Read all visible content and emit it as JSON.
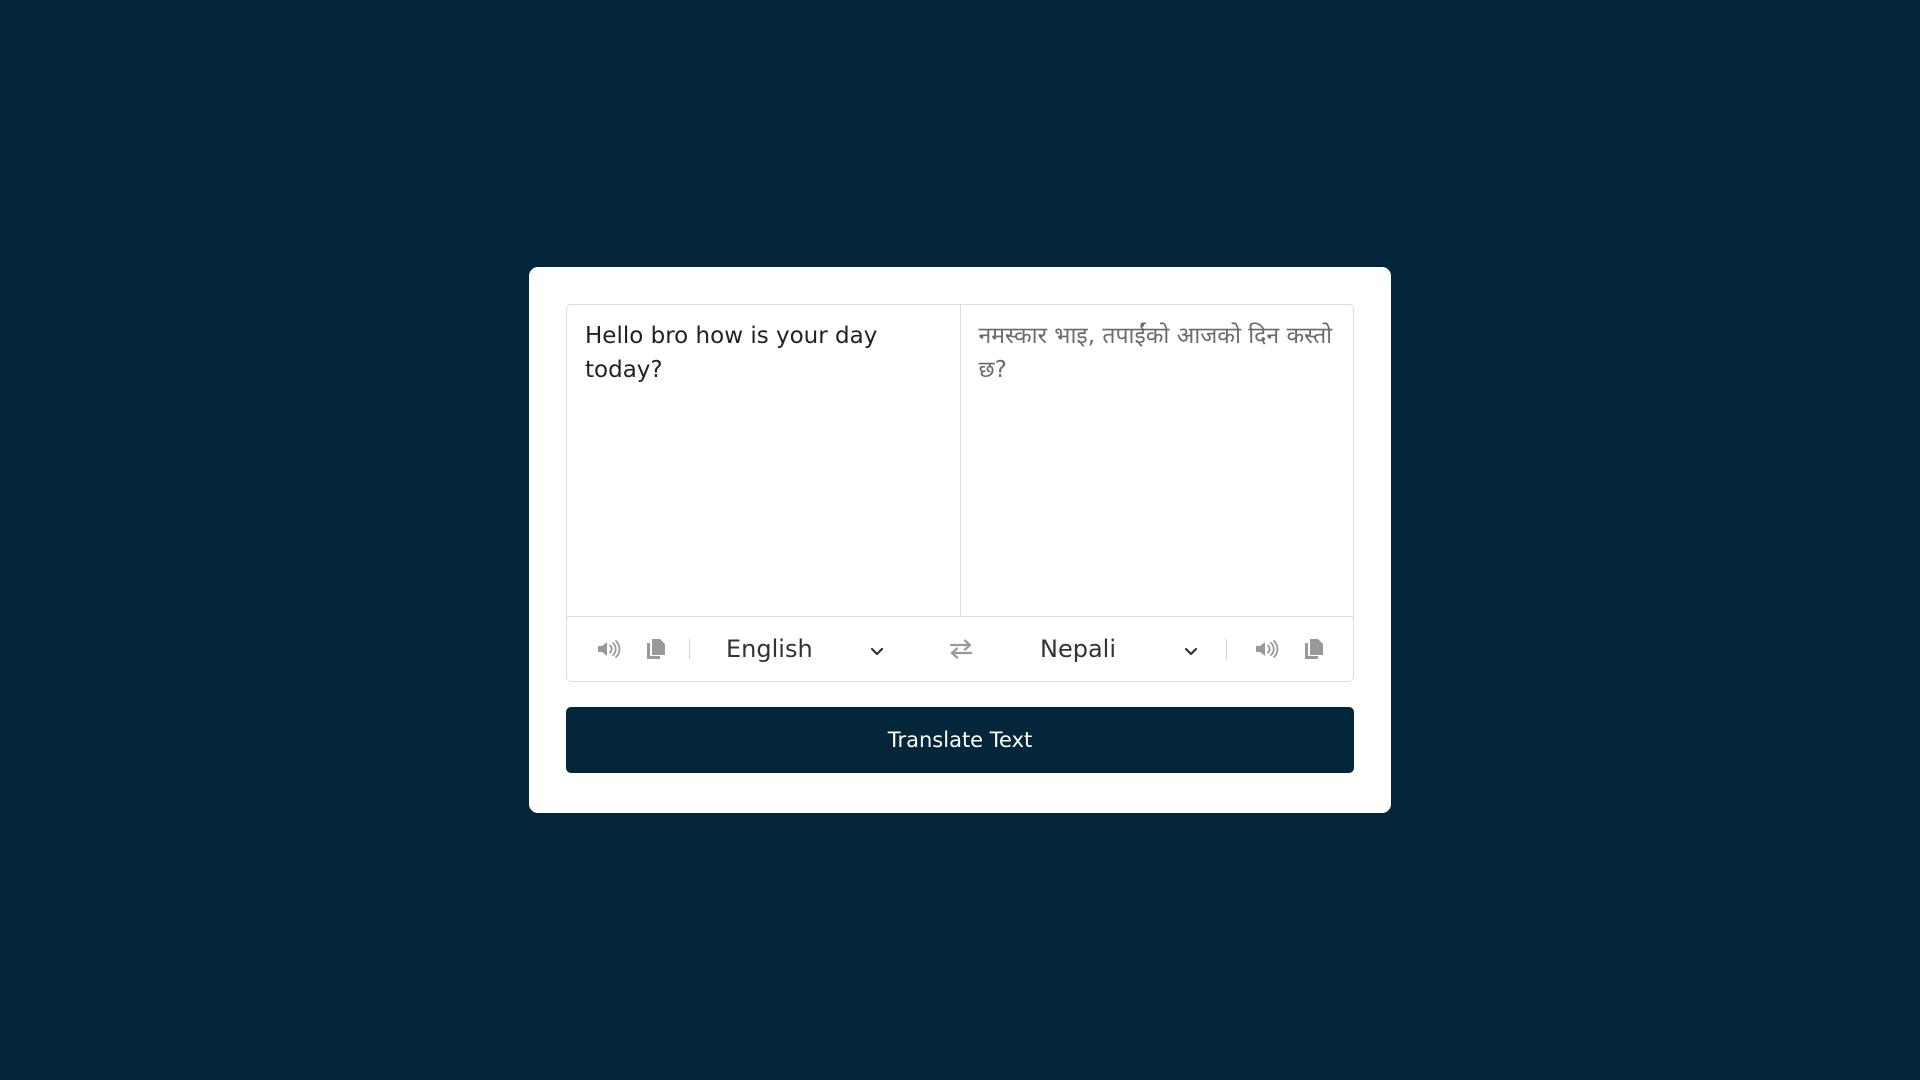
{
  "translator": {
    "from_text": "Hello bro how is your day today?",
    "to_text": "नमस्कार भाइ, तपाईंको आजको दिन कस्तो छ?",
    "from_language": "English",
    "to_language": "Nepali",
    "button_label": "Translate Text"
  },
  "icons": {
    "from_speak": "volume-icon",
    "from_copy": "copy-icon",
    "exchange": "exchange-icon",
    "to_speak": "volume-icon",
    "to_copy": "copy-icon",
    "dropdown": "chevron-down-icon"
  },
  "colors": {
    "background": "#04263a",
    "card": "#ffffff",
    "button": "#04263a",
    "icon": "#999999"
  }
}
